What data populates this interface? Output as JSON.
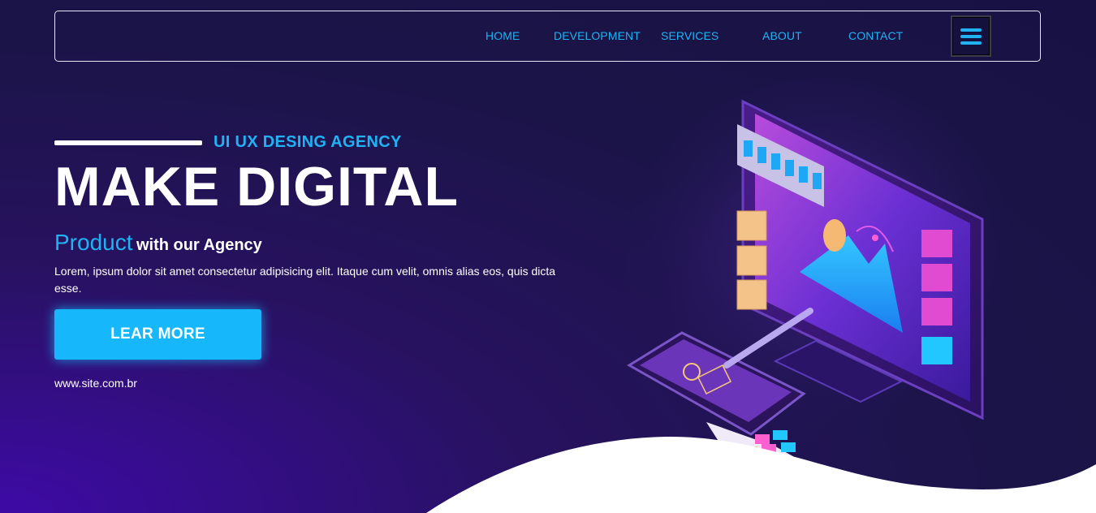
{
  "nav": {
    "items": [
      {
        "label": "HOME"
      },
      {
        "label": "DEVELOPMENT"
      },
      {
        "label": "SERVICES"
      },
      {
        "label": "ABOUT"
      },
      {
        "label": "CONTACT"
      }
    ],
    "menu_icon": "hamburger-menu-icon"
  },
  "hero": {
    "tagline": "UI UX DESING AGENCY",
    "headline": "MAKE DIGITAL",
    "subhead_accent": "Product",
    "subhead_rest": "with our Agency",
    "body": "Lorem, ipsum dolor sit amet consectetur adipisicing elit. Itaque cum velit, omnis alias eos, quis dicta esse.",
    "cta_label": "LEAR MORE",
    "site_url": "www.site.com.br"
  },
  "illustration": {
    "icon": "isometric-design-workstation-illustration"
  },
  "colors": {
    "accent": "#1fb3f3",
    "button": "#17b8fb",
    "background_dark": "#1b1448",
    "background_purple": "#3e0aa6",
    "wave": "#ffffff"
  }
}
